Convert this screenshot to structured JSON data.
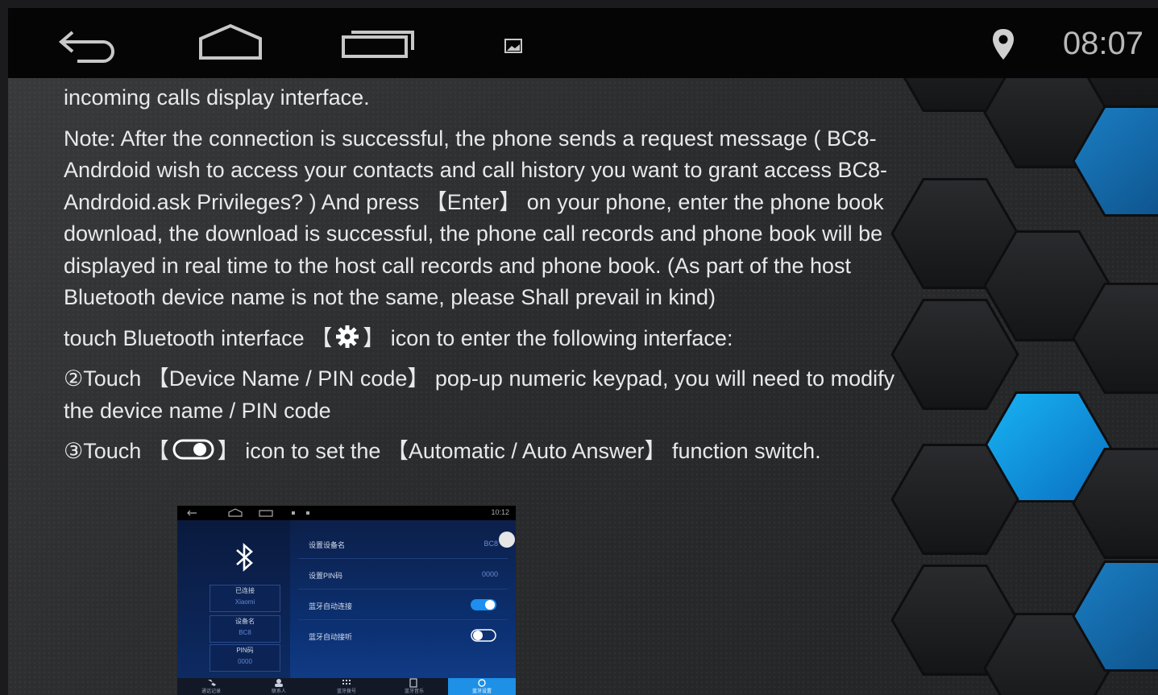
{
  "status_bar": {
    "time": "08:07",
    "icons": [
      "back-icon",
      "home-icon",
      "recents-icon",
      "notification-image-icon",
      "location-pin-icon"
    ]
  },
  "content": {
    "line_partial": "incoming calls display interface.",
    "note": "Note: After the connection is successful, the phone sends a request message ( BC8-Andrdoid wish to access your contacts and call history you want to grant access BC8-Andrdoid.ask Privileges? ) And press 【Enter】 on your phone, enter the phone book download, the download is successful, the phone call records and phone book will be displayed in real time to the host call records and phone book. (As part of the host Bluetooth device name is not the same, please Shall prevail in kind)",
    "touch_bt_prefix": "touch Bluetooth interface 【",
    "touch_bt_suffix": "】 icon to enter the following interface:",
    "step2": "②Touch 【Device Name / PIN code】 pop-up numeric keypad, you will need to modify the device name / PIN code",
    "step3_prefix": "③Touch 【",
    "step3_suffix": "】 icon to set the 【Automatic / Auto Answer】 function switch."
  },
  "screenshot": {
    "status_time": "10:12",
    "left_boxes": [
      {
        "label": "已连接",
        "value": "Xiaomi"
      },
      {
        "label": "设备名",
        "value": "BC8"
      },
      {
        "label": "PIN码",
        "value": "0000"
      }
    ],
    "rows": [
      {
        "label": "设置设备名",
        "value": "BC8"
      },
      {
        "label": "设置PIN码",
        "value": "0000"
      },
      {
        "label": "蓝牙自动连接",
        "toggle": "on"
      },
      {
        "label": "蓝牙自动接听",
        "toggle": "off"
      }
    ],
    "tabs": [
      "通话记录",
      "联系人",
      "蓝牙拨号",
      "蓝牙音乐",
      "蓝牙设置"
    ],
    "active_tab": "蓝牙设置"
  },
  "colors": {
    "status_bar": "#050505",
    "text": "#e9e9e9",
    "hex_blue": "#1aa3e8",
    "hex_dark": "#1f2022",
    "clock": "#b8b8b8"
  }
}
